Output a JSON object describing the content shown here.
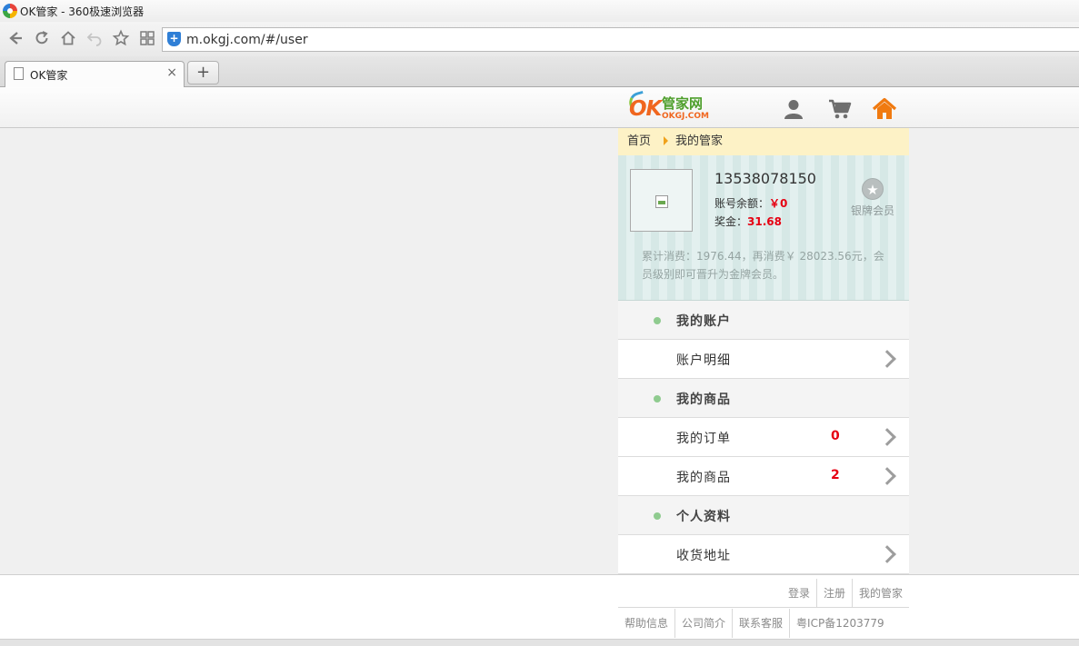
{
  "browser": {
    "window_title": "OK管家 - 360极速浏览器",
    "url": "m.okgj.com/#/user",
    "tab_title": "OK管家",
    "tab_close": "×",
    "new_tab": "+",
    "nav_icons": [
      "back-icon",
      "refresh-icon",
      "home-icon",
      "undo-icon",
      "favorite-icon",
      "apps-icon"
    ]
  },
  "header": {
    "logo_ok": "OK",
    "logo_cn": "管家网",
    "logo_domain": "OKGJ.COM",
    "icons": [
      "user-icon",
      "cart-icon",
      "home-icon"
    ],
    "icon_colors": {
      "user": "#6e6e6e",
      "cart": "#6e6e6e",
      "home": "#f07a10"
    }
  },
  "breadcrumb": {
    "home": "首页",
    "current": "我的管家"
  },
  "profile": {
    "phone": "13538078150",
    "balance_label": "账号余额：",
    "balance_value": "￥0",
    "bonus_label": "奖金：",
    "bonus_value": "31.68",
    "member_level": "银牌会员",
    "upgrade_note": "累计消费：1976.44，再消费￥ 28023.56元，会员级别即可晋升为金牌会员。"
  },
  "menu": {
    "account_section": "我的账户",
    "account_detail": "账户明细",
    "goods_section": "我的商品",
    "orders": "我的订单",
    "orders_count": "0",
    "goods": "我的商品",
    "goods_count": "2",
    "profile_section": "个人资料",
    "address": "收货地址"
  },
  "footer": {
    "row1": [
      "登录",
      "注册",
      "我的管家"
    ],
    "row2": [
      "帮助信息",
      "公司简介",
      "联系客服",
      "粤ICP备1203779"
    ]
  },
  "colors": {
    "accent_red": "#e60012",
    "breadcrumb_bg": "#fdf2c6",
    "profile_bg": "#d8eae8"
  }
}
